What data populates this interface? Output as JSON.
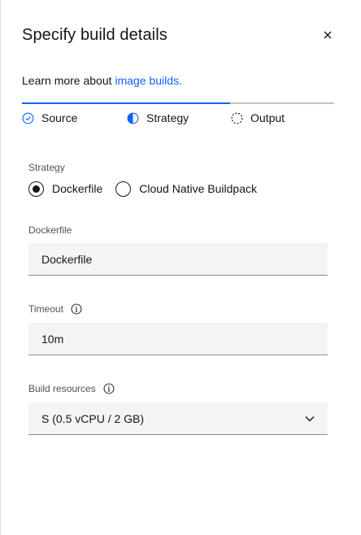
{
  "panel": {
    "title": "Specify build details",
    "learn_prefix": "Learn more about ",
    "learn_link": "image builds."
  },
  "steps": [
    {
      "label": "Source",
      "state": "complete"
    },
    {
      "label": "Strategy",
      "state": "current"
    },
    {
      "label": "Output",
      "state": "incomplete"
    }
  ],
  "strategy": {
    "label": "Strategy",
    "options": [
      {
        "label": "Dockerfile",
        "selected": true
      },
      {
        "label": "Cloud Native Buildpack",
        "selected": false
      }
    ]
  },
  "dockerfile": {
    "label": "Dockerfile",
    "value": "Dockerfile"
  },
  "timeout": {
    "label": "Timeout",
    "value": "10m"
  },
  "resources": {
    "label": "Build resources",
    "value": "S (0.5 vCPU / 2 GB)"
  },
  "colors": {
    "accent": "#0f62fe",
    "field_bg": "#f4f4f4",
    "text": "#161616",
    "label": "#525252"
  }
}
